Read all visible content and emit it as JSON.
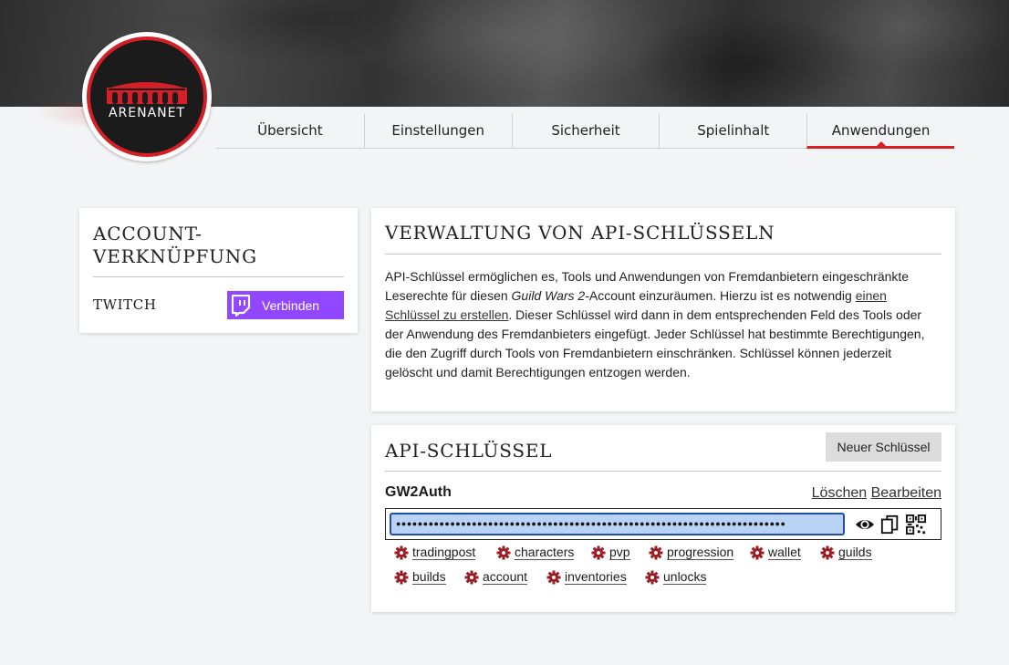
{
  "header": {
    "logo_text": "ARENANET",
    "tabs": [
      {
        "label": "Übersicht",
        "active": false
      },
      {
        "label": "Einstellungen",
        "active": false
      },
      {
        "label": "Sicherheit",
        "active": false
      },
      {
        "label": "Spielinhalt",
        "active": false
      },
      {
        "label": "Anwendungen",
        "active": true
      }
    ]
  },
  "account_link": {
    "title": "ACCOUNT-VERKNÜPFUNG",
    "service": "TWITCH",
    "connect_label": "Verbinden",
    "twitch_color": "#9146ff"
  },
  "api_info": {
    "title": "VERWALTUNG VON API-SCHLÜSSELN",
    "text_part1": "API-Schlüssel ermöglichen es, Tools und Anwendungen von Fremdanbietern eingeschränkte Leserechte für diesen ",
    "text_game": "Guild Wars 2",
    "text_part2": "-Account einzuräumen. Hierzu ist es notwendig ",
    "text_link": "einen Schlüssel zu erstellen",
    "text_part3": ". Dieser Schlüssel wird dann in dem entsprechenden Feld des Tools oder der Anwendung des Fremdanbieters eingefügt. Jeder Schlüssel hat bestimmte Berechtigungen, die den Zugriff durch Tools von Fremdanbietern einschränken. Schlüssel können jederzeit gelöscht und damit Berechtigungen entzogen werden."
  },
  "api_keys": {
    "title": "API-SCHLÜSSEL",
    "new_key_label": "Neuer Schlüssel",
    "key": {
      "name": "GW2Auth",
      "delete_label": "Löschen",
      "edit_label": "Bearbeiten",
      "masked_value": "●●●●●●●●●●●●●●●●●●●●●●●●●●●●●●●●●●●●●●●●●●●●●●●●●●●●●●●●●●●●●●●●●●●●●●●●",
      "permissions": [
        "tradingpost",
        "characters",
        "pvp",
        "progression",
        "wallet",
        "guilds",
        "builds",
        "account",
        "inventories",
        "unlocks"
      ]
    }
  },
  "colors": {
    "brand_red": "#d51f26",
    "gear_red": "#9b1c22",
    "selection_blue": "#b9d3f6"
  }
}
